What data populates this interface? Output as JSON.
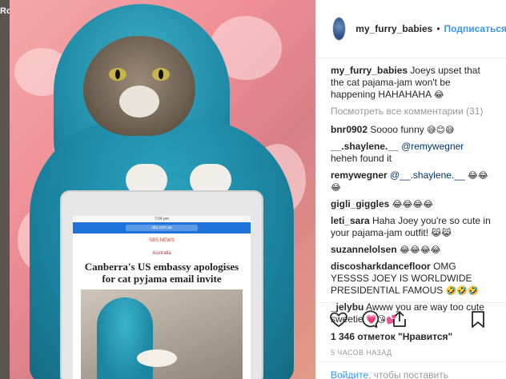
{
  "backdrop": {
    "edge_text": "Ro"
  },
  "photo": {
    "tablet_status": "7:04 pm",
    "tablet_url": "sbs.com.au",
    "news_logo": "SBS NEWS",
    "news_section": "Australia",
    "news_headline": "Canberra's US embassy apologises for cat pyjama email invite"
  },
  "header": {
    "username": "my_furry_babies",
    "dot": "•",
    "follow_label": "Подписаться"
  },
  "caption": {
    "user": "my_furry_babies",
    "text": "Joeys upset that the cat pajama-jam won't be happening HAHAHAHA",
    "emoji": "😂"
  },
  "view_all_comments": "Посмотреть все комментарии (31)",
  "comments": [
    {
      "user": "bnr0902",
      "text": "Soooo funny",
      "mention": "",
      "emoji": "😅😊😅"
    },
    {
      "user": "__.shaylene.__",
      "text": "heheh found it",
      "mention": "@remywegner",
      "emoji": ""
    },
    {
      "user": "remywegner",
      "text": "",
      "mention": "@__.shaylene.__",
      "emoji": "😂😂😂"
    },
    {
      "user": "gigli_giggles",
      "text": "",
      "mention": "",
      "emoji": "😂😂😂😂"
    },
    {
      "user": "leti_sara",
      "text": "Haha Joey you're so cute in your pajama-jam outfit!",
      "mention": "",
      "emoji": "😹😹"
    },
    {
      "user": "suzannelolsen",
      "text": "",
      "mention": "",
      "emoji": "😂😂😂😂"
    },
    {
      "user": "discosharkdancefloor",
      "text": "OMG YESSSS JOEY IS WORLDWIDE PRESIDENTIAL FAMOUS",
      "mention": "",
      "emoji": "🤣🤣🤣"
    },
    {
      "user": "_jelybu",
      "text": "Awww you are way too cute sweetie",
      "mention": "",
      "emoji": "💗😘💕"
    }
  ],
  "actions": {
    "like_icon": "heart-icon",
    "comment_icon": "comment-icon",
    "share_icon": "share-icon",
    "save_icon": "bookmark-icon"
  },
  "likes": "1 346 отметок \"Нравится\"",
  "timestamp": "5 ЧАСОВ НАЗАД",
  "login": {
    "link": "Войдите",
    "text": ", чтобы поставить"
  }
}
